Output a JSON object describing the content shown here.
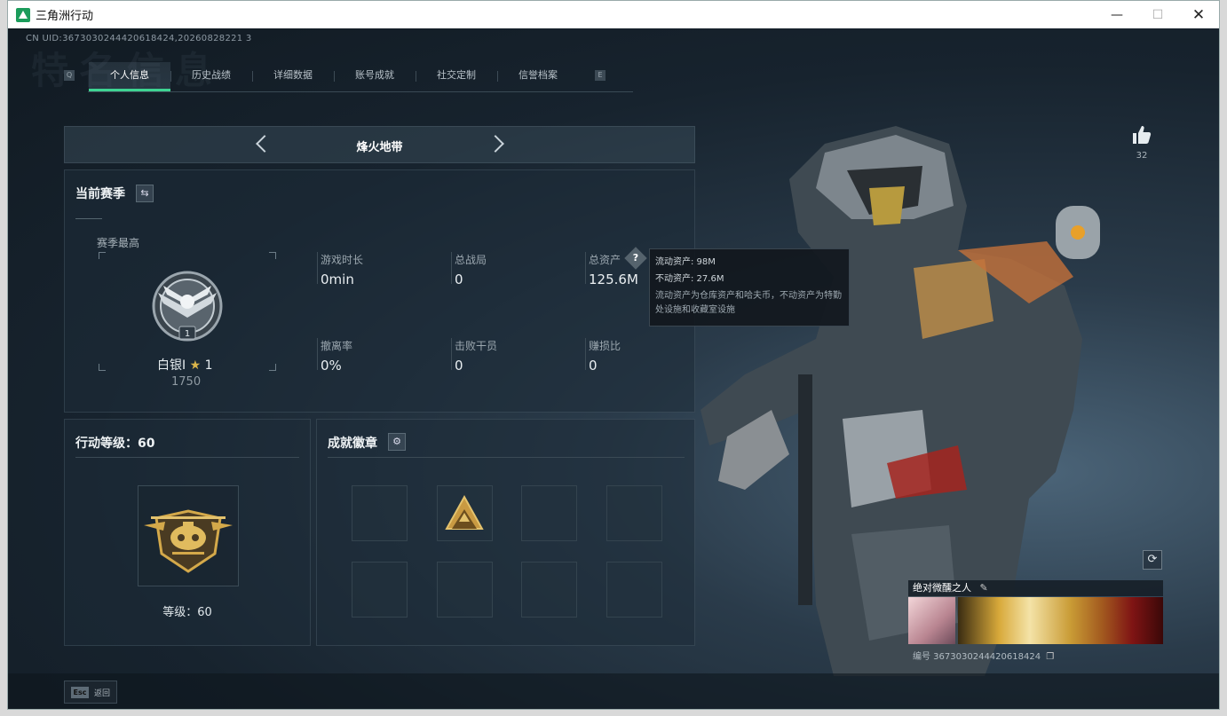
{
  "window": {
    "title": "三角洲行动"
  },
  "header": {
    "uid": "CN UID:3673030244420618424,20260828221 3",
    "bg_word": "特名信息"
  },
  "tabs": [
    {
      "label": "个人信息"
    },
    {
      "label": "历史战绩"
    },
    {
      "label": "详细数据"
    },
    {
      "label": "账号成就"
    },
    {
      "label": "社交定制"
    },
    {
      "label": "信誉档案"
    }
  ],
  "tab_keys": {
    "left": "Q",
    "right": "E"
  },
  "mode": {
    "label": "烽火地带"
  },
  "season": {
    "title": "当前赛季",
    "best_label": "赛季最高",
    "rank_name": "白银I",
    "rank_stars": "1",
    "rank_points": "1750",
    "badge_level": "1",
    "stats": [
      {
        "label": "游戏时长",
        "value": "0min"
      },
      {
        "label": "总战局",
        "value": "0"
      },
      {
        "label": "总资产",
        "value": "125.6M"
      },
      {
        "label": "撤离率",
        "value": "0%"
      },
      {
        "label": "击败干员",
        "value": "0"
      },
      {
        "label": "赚损比",
        "value": "0"
      }
    ]
  },
  "tooltip": {
    "liquid": "流动资产: 98M",
    "fixed": "不动资产: 27.6M",
    "desc": "流动资产为仓库资产和哈夫币，不动资产为特勤处设施和收藏室设施"
  },
  "level_panel": {
    "title": "行动等级：60",
    "level_text": "等级：60"
  },
  "badge_panel": {
    "title": "成就徽章"
  },
  "likes": {
    "count": "32"
  },
  "card": {
    "name": "绝对微醺之人",
    "code": "编号 3673030244420618424"
  },
  "footer": {
    "esc_key": "Esc",
    "back_label": "返回"
  },
  "colors": {
    "accent": "#3ed492",
    "panel": "#1e2c38",
    "gold": "#d4a94a"
  }
}
